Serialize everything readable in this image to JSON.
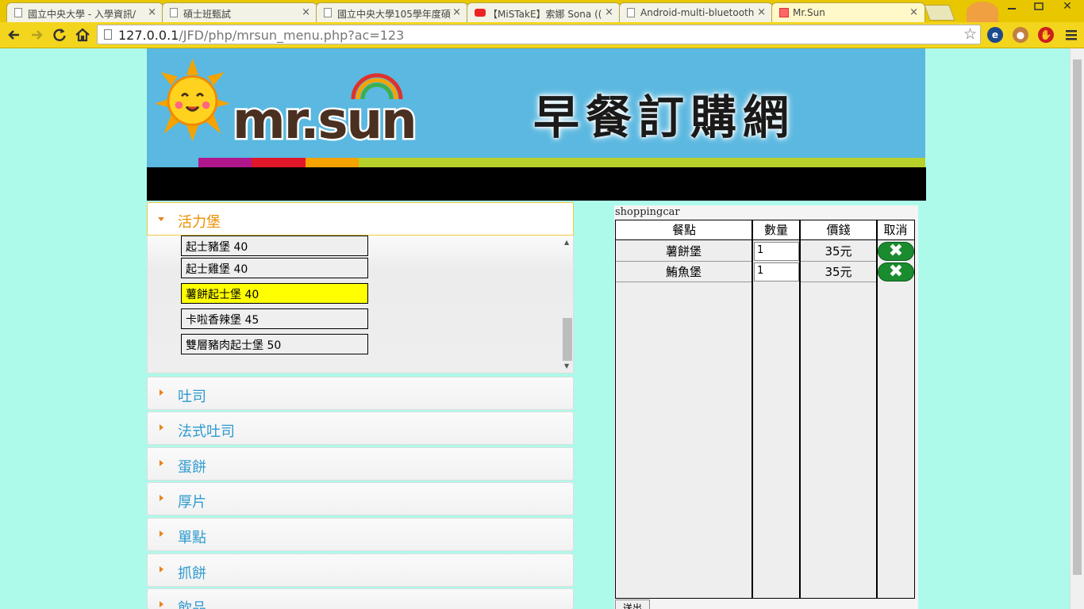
{
  "browser": {
    "tabs": [
      {
        "title": "國立中央大學 - 入學資訊/"
      },
      {
        "title": "碩士班甄試"
      },
      {
        "title": "國立中央大學105學年度碩"
      },
      {
        "title": "【MiSTakE】索娜 Sona (("
      },
      {
        "title": "Android-multi-bluetooth"
      },
      {
        "title": "Mr.Sun"
      }
    ],
    "tab_close": "×",
    "url_host": "127.0.0.1",
    "url_path": "/JFD/php/mrsun_menu.php?ac=123",
    "window_controls": {
      "minimize": "最小化",
      "restore": "還原",
      "close": "✕"
    }
  },
  "header": {
    "logo_text": "mr.sun",
    "site_title": "早餐訂購網"
  },
  "menu": {
    "open_category": "活力堡",
    "items": [
      {
        "name": "起士豬堡",
        "price": "40"
      },
      {
        "name": "起士雞堡",
        "price": "40"
      },
      {
        "name": "薯餅起士堡",
        "price": "40"
      },
      {
        "name": "卡啦香辣堡",
        "price": "45"
      },
      {
        "name": "雙層豬肉起士堡",
        "price": "50"
      }
    ],
    "item_labels": [
      "起士豬堡 40",
      "起士雞堡 40",
      "薯餅起士堡 40",
      "卡啦香辣堡 45",
      "雙層豬肉起士堡 50"
    ],
    "selected_index": 2,
    "categories": [
      "吐司",
      "法式吐司",
      "蛋餅",
      "厚片",
      "單點",
      "抓餅",
      "飲品"
    ]
  },
  "cart": {
    "title": "shoppingcar",
    "headers": {
      "item": "餐點",
      "qty": "數量",
      "price": "價錢",
      "cancel": "取消"
    },
    "rows": [
      {
        "item": "薯餅堡",
        "qty": "1",
        "price": "35元"
      },
      {
        "item": "鮪魚堡",
        "qty": "1",
        "price": "35元"
      }
    ],
    "submit_label": "送出"
  },
  "colors": {
    "page_bg": "#adfaea",
    "header_bg": "#5bb8e0",
    "accent_orange": "#eb8f00",
    "category_blue": "#2e9bcf",
    "selected_item": "#ffff00",
    "cancel_green": "#1a8c2f"
  }
}
